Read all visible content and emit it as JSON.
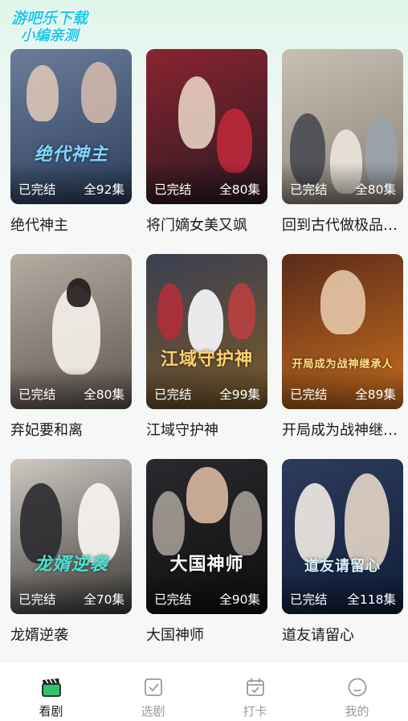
{
  "watermark": {
    "line1": "游吧乐下载",
    "line2": "小编亲测"
  },
  "dramas": [
    {
      "name": "绝代神主",
      "status": "已完结",
      "episodes": "全92集",
      "poster_title": "绝代神主",
      "colors": [
        "#6a7d9a",
        "#2c3e5c"
      ]
    },
    {
      "name": "将门嫡女美又飒",
      "status": "已完结",
      "episodes": "全80集",
      "poster_title": "",
      "colors": [
        "#8a2430",
        "#2a1a22"
      ]
    },
    {
      "name": "回到古代做极品家丁",
      "status": "已完结",
      "episodes": "全80集",
      "poster_title": "",
      "colors": [
        "#c9c0b4",
        "#8a8178"
      ]
    },
    {
      "name": "弃妃要和离",
      "status": "已完结",
      "episodes": "全80集",
      "poster_title": "",
      "colors": [
        "#b7aca2",
        "#5f5650"
      ]
    },
    {
      "name": "江域守护神",
      "status": "已完结",
      "episodes": "全99集",
      "poster_title": "江域守护神",
      "colors": [
        "#3a3f52",
        "#7b5a2a"
      ]
    },
    {
      "name": "开局成为战神继承人",
      "status": "已完结",
      "episodes": "全89集",
      "poster_title": "开局成为战神继承人",
      "colors": [
        "#5a2a1a",
        "#c9701e"
      ]
    },
    {
      "name": "龙婿逆袭",
      "status": "已完结",
      "episodes": "全70集",
      "poster_title": "龙婿逆袭",
      "colors": [
        "#cfc9c2",
        "#3c3a38"
      ]
    },
    {
      "name": "大国神师",
      "status": "已完结",
      "episodes": "全90集",
      "poster_title": "大国神师",
      "colors": [
        "#2a2a2e",
        "#0e0e10"
      ]
    },
    {
      "name": "道友请留心",
      "status": "已完结",
      "episodes": "全118集",
      "poster_title": "道友请留心",
      "colors": [
        "#2e3b5c",
        "#0f1e3a"
      ]
    }
  ],
  "tabs": [
    {
      "label": "看剧",
      "icon": "clapperboard-icon",
      "active": true
    },
    {
      "label": "选剧",
      "icon": "checklist-icon",
      "active": false
    },
    {
      "label": "打卡",
      "icon": "calendar-check-icon",
      "active": false
    },
    {
      "label": "我的",
      "icon": "profile-smile-icon",
      "active": false
    }
  ],
  "accent_color": "#33c26a"
}
